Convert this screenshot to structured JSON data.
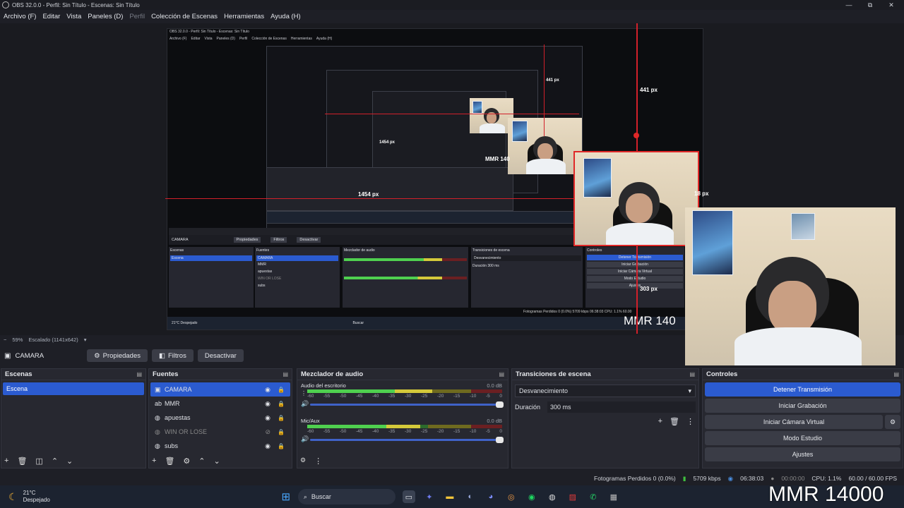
{
  "window": {
    "title": "OBS 32.0.0 - Perfil: Sin Título - Escenas: Sin Título",
    "minimize": "—",
    "maximize": "⧉",
    "close": "✕"
  },
  "menu": [
    "Archivo (F)",
    "Editar",
    "Vista",
    "Paneles (D)",
    "Perfil",
    "Colección de Escenas",
    "Herramientas",
    "Ayuda (H)"
  ],
  "preview": {
    "nested_title": "OBS 32.0.0 - Perfil: Sin Título - Escenas: Sin Título",
    "nested_menu": [
      "Archivo (F)",
      "Editar",
      "Vista",
      "Paneles (D)",
      "Perfil",
      "Colección de Escenas",
      "Herramientas",
      "Ayuda (H)"
    ],
    "px_labels": {
      "a": "441 px",
      "b": "441 px",
      "c": "1454 px",
      "d": "1454 px",
      "e": "18 px",
      "f": "303 px"
    },
    "mmr_small": "MMR 140",
    "mmr_mid": "MMR 140",
    "nested_bottom": {
      "source": "CAMARA",
      "props": "Propiedades",
      "filters": "Filtros",
      "deactivate": "Desactivar",
      "scenes": "Escenas",
      "sources": "Fuentes",
      "mixer": "Mezclador de audio",
      "transitions": "Transiciones de escena",
      "controls": "Controles",
      "scene": "Escena",
      "items": [
        "CAMARA",
        "MMR",
        "apuestas",
        "WIN OR LOSE",
        "subs"
      ],
      "stop": "Detener Transmisión",
      "rec": "Iniciar Grabación",
      "vcam": "Iniciar Cámara Virtual",
      "studio": "Modo Estudio",
      "settings": "Ajustes",
      "fade": "Desvanecimiento",
      "duration": "Duración",
      "ms": "300 ms",
      "stats": "Fotogramas Perdidos 0 (0.0%)   5709 kbps   06:38:03   CPU: 1.1%   60.00",
      "weather": "21°C Despejado",
      "search": "Buscar"
    }
  },
  "preview_bar": {
    "zoom": "59%",
    "scale": "Escalado (1141x642)"
  },
  "source_toolbar": {
    "name": "CAMARA",
    "properties": "Propiedades",
    "filters": "Filtros",
    "deactivate": "Desactivar"
  },
  "scenes": {
    "title": "Escenas",
    "items": [
      "Escena"
    ]
  },
  "sources": {
    "title": "Fuentes",
    "items": [
      {
        "name": "CAMARA",
        "icon": "camera-icon"
      },
      {
        "name": "MMR",
        "icon": "text-icon"
      },
      {
        "name": "apuestas",
        "icon": "browser-icon"
      },
      {
        "name": "WIN OR LOSE",
        "icon": "browser-icon"
      },
      {
        "name": "subs",
        "icon": "browser-icon"
      }
    ]
  },
  "mixer": {
    "title": "Mezclador de audio",
    "channels": [
      {
        "name": "Audio del escritorio",
        "db": "0.0 dB",
        "level": 0.64
      },
      {
        "name": "Mic/Aux",
        "db": "0.0 dB",
        "level": 0.58
      }
    ],
    "ticks": [
      "-60",
      "-55",
      "-50",
      "-45",
      "-40",
      "-35",
      "-30",
      "-25",
      "-20",
      "-15",
      "-10",
      "-5",
      "0"
    ]
  },
  "transitions": {
    "title": "Transiciones de escena",
    "selected": "Desvanecimiento",
    "duration_label": "Duración",
    "duration": "300 ms"
  },
  "controls": {
    "title": "Controles",
    "stop_stream": "Detener Transmisión",
    "start_rec": "Iniciar Grabación",
    "virtual_cam": "Iniciar Cámara Virtual",
    "studio": "Modo Estudio",
    "settings": "Ajustes"
  },
  "status": {
    "dropped": "Fotogramas Perdidos 0 (0.0%)",
    "bitrate": "5709 kbps",
    "stream_time": "06:38:03",
    "rec_time": "00:00:00",
    "cpu": "CPU: 1.1%",
    "fps": "60.00 / 60.00 FPS"
  },
  "taskbar": {
    "temp": "21°C",
    "weather": "Despejado",
    "search": "Buscar"
  },
  "overlay": {
    "mmr": "MMR 14000"
  },
  "colors": {
    "accent": "#2b5bd0",
    "red_guide": "#d2202a",
    "panel": "#272830"
  }
}
